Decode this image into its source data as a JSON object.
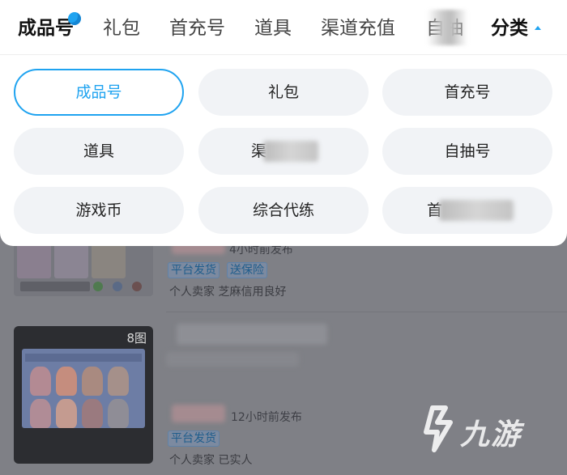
{
  "tabs": [
    {
      "label": "成品号",
      "active": true
    },
    {
      "label": "礼包"
    },
    {
      "label": "首充号"
    },
    {
      "label": "道具"
    },
    {
      "label": "渠道充值"
    },
    {
      "label": "自抽"
    }
  ],
  "category": {
    "label": "分类",
    "caret": "caret-up-icon"
  },
  "dropdown": {
    "options": [
      {
        "label": "成品号",
        "selected": true
      },
      {
        "label": "礼包"
      },
      {
        "label": "首充号"
      },
      {
        "label": "道具"
      },
      {
        "label": "渠"
      },
      {
        "label": "自抽号"
      },
      {
        "label": "游戏币"
      },
      {
        "label": "综合代练"
      },
      {
        "label": "首"
      }
    ]
  },
  "listings": [
    {
      "posted": "4小时前发布",
      "tags": [
        "平台发货",
        "送保险"
      ],
      "meta": "个人卖家  芝麻信用良好"
    },
    {
      "image_count": "8图",
      "posted": "12小时前发布",
      "tags": [
        "平台发货"
      ],
      "meta": "个人卖家  已实人"
    }
  ],
  "watermark": {
    "text": "九游"
  },
  "colors": {
    "accent": "#1fa3f0",
    "overlay": "#7f8086",
    "chip_bg": "#f1f3f6"
  }
}
